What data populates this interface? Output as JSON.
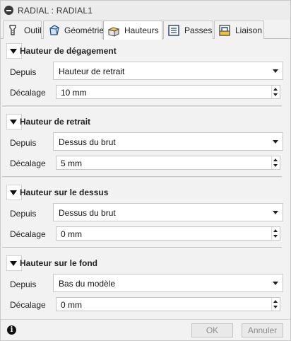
{
  "window": {
    "title": "RADIAL : RADIAL1"
  },
  "tabs": [
    {
      "label": "Outil",
      "icon": "tool-icon"
    },
    {
      "label": "Géométrie",
      "icon": "geometry-icon"
    },
    {
      "label": "Hauteurs",
      "icon": "heights-icon",
      "active": true
    },
    {
      "label": "Passes",
      "icon": "passes-icon"
    },
    {
      "label": "Liaison",
      "icon": "linking-icon"
    }
  ],
  "sections": [
    {
      "title": "Hauteur de dégagement",
      "from_label": "Depuis",
      "from_value": "Hauteur de retrait",
      "offset_label": "Décalage",
      "offset_value": "10 mm"
    },
    {
      "title": "Hauteur de retrait",
      "from_label": "Depuis",
      "from_value": "Dessus du brut",
      "offset_label": "Décalage",
      "offset_value": "5 mm"
    },
    {
      "title": "Hauteur sur le dessus",
      "from_label": "Depuis",
      "from_value": "Dessus du brut",
      "offset_label": "Décalage",
      "offset_value": "0 mm"
    },
    {
      "title": "Hauteur sur le fond",
      "from_label": "Depuis",
      "from_value": "Bas du modèle",
      "offset_label": "Décalage",
      "offset_value": "0 mm"
    }
  ],
  "footer": {
    "ok_label": "OK",
    "cancel_label": "Annuler"
  },
  "colors": {
    "panel_bg": "#f2f2f2",
    "active_tab_bg": "#ffffff",
    "disabled_text": "#8c8c8c"
  }
}
